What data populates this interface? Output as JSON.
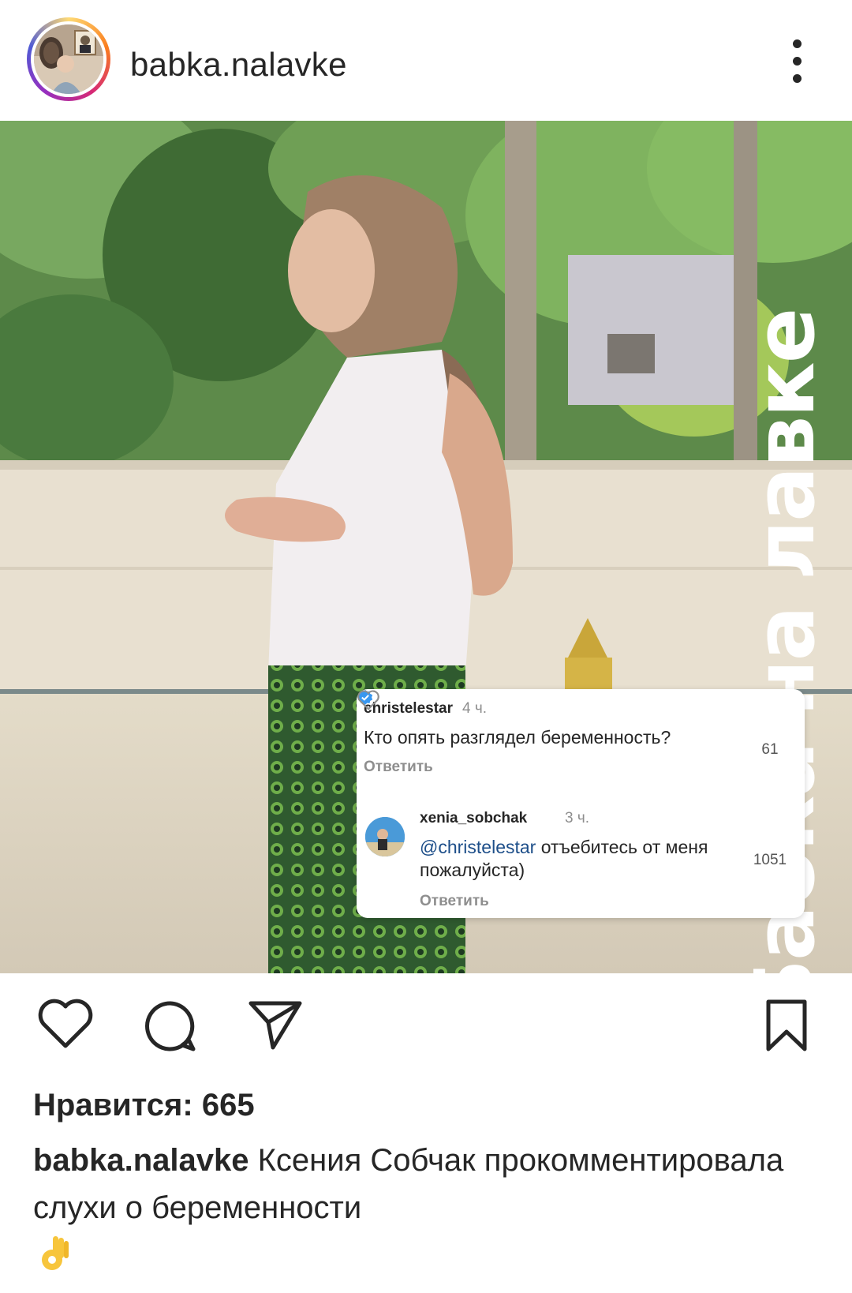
{
  "header": {
    "username": "babka.nalavke"
  },
  "photo": {
    "brand_vertical": "Бабка на лавке"
  },
  "comments": [
    {
      "user": "christelestar",
      "time": "4 ч.",
      "text": "Кто опять разглядел беременность?",
      "reply_label": "Ответить",
      "likes": "61"
    },
    {
      "user": "xenia_sobchak",
      "time": "3 ч.",
      "mention": "@christelestar",
      "text": " отъебитесь от меня пожалуйста)",
      "reply_label": "Ответить",
      "likes": "1051",
      "verified": true
    }
  ],
  "post": {
    "likes_text": "Нравится: 665",
    "caption_user": "babka.nalavke",
    "caption_text": " Ксения Собчак прокомментировала слухи о беременности"
  },
  "icons": {
    "more": "more-vertical-icon",
    "like": "heart-icon",
    "comment": "comment-bubble-icon",
    "share": "paper-plane-icon",
    "save": "bookmark-icon",
    "emoji": "ok-hand-emoji"
  },
  "colors": {
    "text": "#262626",
    "muted": "#8e8e8e",
    "mention": "#1d4e89",
    "verified": "#3897f0"
  }
}
